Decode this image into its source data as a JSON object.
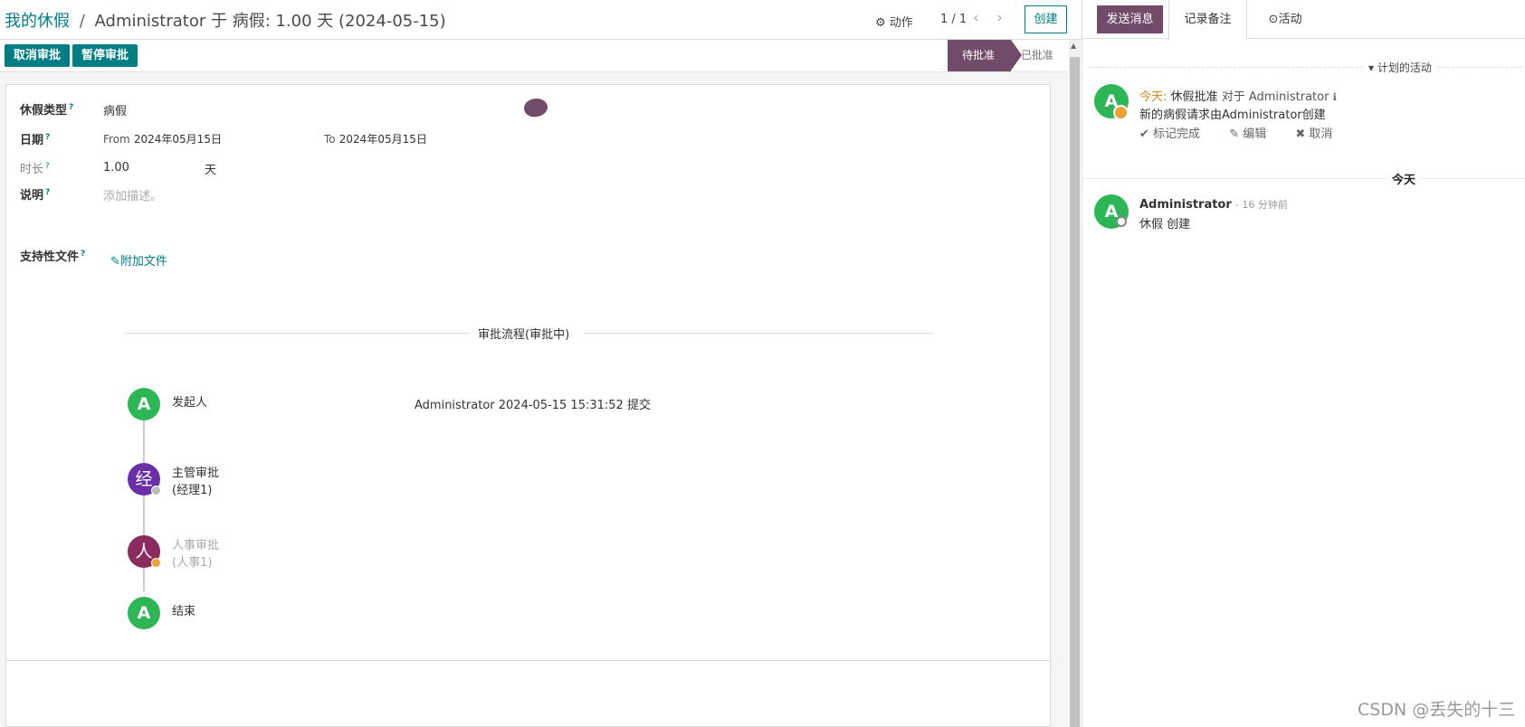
{
  "breadcrumb": {
    "parent": "我的休假",
    "separator": "/",
    "current": "Administrator 于 病假: 1.00 天 (2024-05-15)"
  },
  "toolbar": {
    "action_label": "动作",
    "pager": "1 / 1",
    "create_label": "创建"
  },
  "actions": {
    "cancel_label": "取消审批",
    "pause_label": "暂停审批"
  },
  "status": {
    "active": "待批准",
    "next": "已批准"
  },
  "form": {
    "leave_type_label": "休假类型",
    "leave_type_value": "病假",
    "date_label": "日期",
    "from_label": "From",
    "from_value": "2024年05月15日",
    "to_label": "To",
    "to_value": "2024年05月15日",
    "duration_label": "时长",
    "duration_value": "1.00",
    "duration_unit": "天",
    "desc_label": "说明",
    "desc_placeholder": "添加描述。",
    "attach_label": "支持性文件",
    "attach_link": "附加文件",
    "help_mark": "?"
  },
  "flow": {
    "title": "审批流程(审批中)",
    "steps": [
      {
        "avatar": "A",
        "name": "发起人",
        "sub": "",
        "color": "#2db656"
      },
      {
        "avatar": "经",
        "name": "主管审批",
        "sub": "(经理1)",
        "color": "#6a2fa8"
      },
      {
        "avatar": "人",
        "name": "人事审批",
        "sub": "(人事1)",
        "color": "#8a2c5e"
      },
      {
        "avatar": "A",
        "name": "结束",
        "sub": "",
        "color": "#2db656"
      }
    ],
    "initiator_info": "Administrator 2024-05-15 15:31:52 提交"
  },
  "chatter": {
    "send_message": "发送消息",
    "log_note": "记录备注",
    "activity": "活动",
    "planned_title": "计划的活动",
    "activity_item": {
      "avatar": "A",
      "when": "今天:",
      "type": "休假批准",
      "for_text": "对于 Administrator",
      "summary": "新的病假请求由Administrator创建",
      "mark_done": "标记完成",
      "edit": "编辑",
      "cancel": "取消"
    },
    "today_divider": "今天",
    "message": {
      "avatar": "A",
      "author": "Administrator",
      "time": "- 16 分钟前",
      "body": "休假 创建"
    }
  },
  "watermark": "CSDN @丢失的十三",
  "colors": {
    "primary": "#017e84",
    "brand": "#714b67",
    "avatar_green": "#2db656"
  }
}
